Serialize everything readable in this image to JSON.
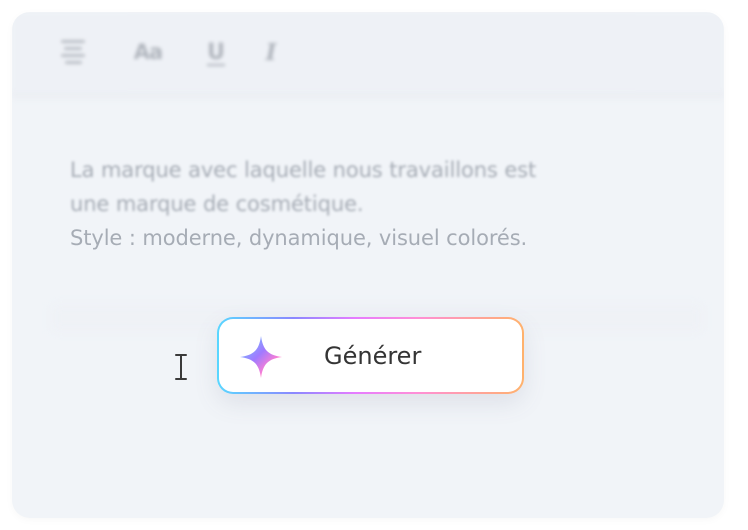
{
  "editor": {
    "toolbar": {
      "font_label": "Aa",
      "underline_label": "U",
      "italic_label": "I"
    },
    "text_lines": [
      "La marque avec laquelle nous travaillons est",
      "une marque de cosmétique.",
      "Style : moderne, dynamique, visuel colorés."
    ]
  },
  "action": {
    "generate_label": "Générer",
    "icon": "sparkle-icon",
    "gradient": [
      "#59d7ff",
      "#8b88ff",
      "#e67cff",
      "#ffb26c"
    ]
  },
  "cursor": {
    "icon": "text-cursor-icon"
  }
}
